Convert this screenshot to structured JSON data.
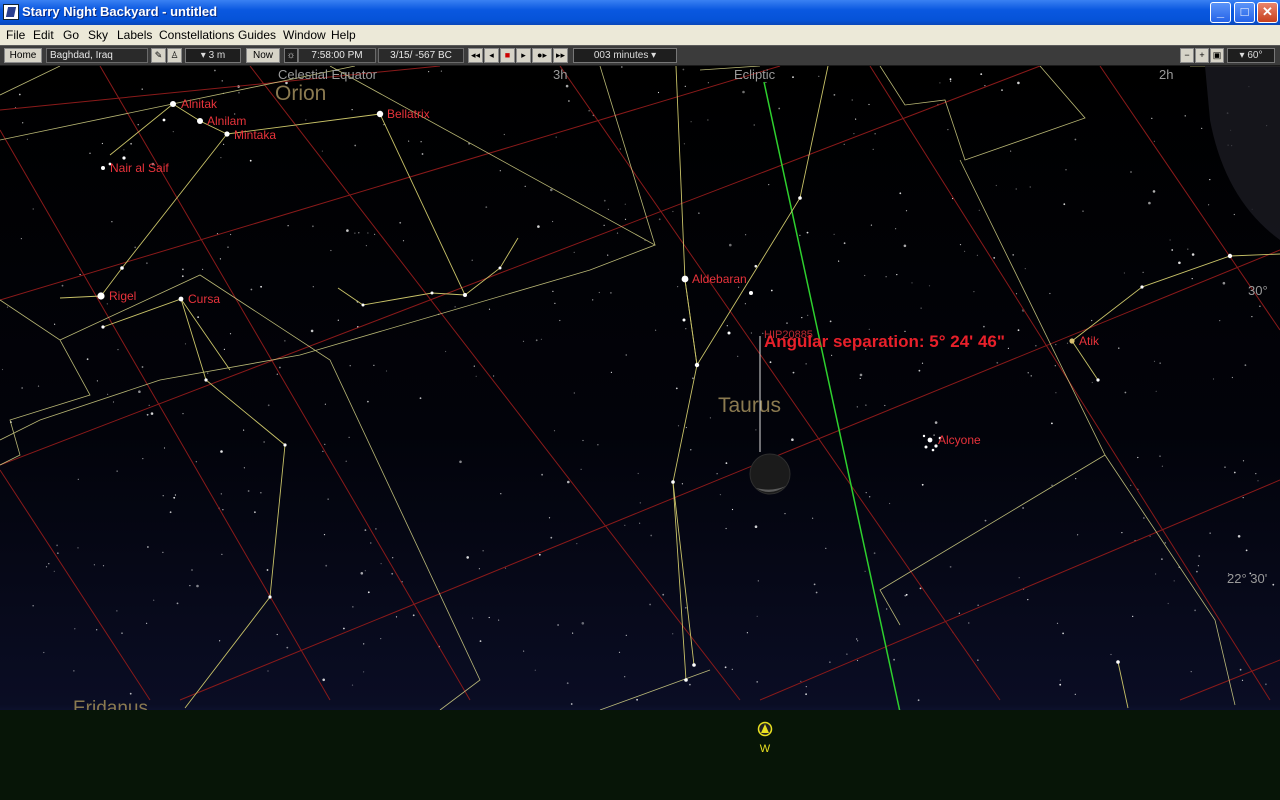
{
  "window": {
    "title": "Starry Night Backyard - untitled",
    "buttons": {
      "minimize": "_",
      "maximize": "□",
      "close": "✕"
    }
  },
  "menu": [
    "File",
    "Edit",
    "Go",
    "Sky",
    "Labels",
    "Constellations",
    "Guides",
    "Window",
    "Help"
  ],
  "toolbar": {
    "home_label": "Home",
    "location": "Baghdad, Iraq",
    "elevation": "▾ 3 m",
    "now_label": "Now",
    "time": "7:58:00 PM",
    "date": "3/15/ -567 BC",
    "time_step": "003 minutes ▾",
    "fov": "▾ 60°"
  },
  "sky": {
    "grid_labels": {
      "celestial_equator": "Celestial Equator",
      "ecliptic": "Ecliptic",
      "ra_3h": "3h",
      "ra_2h": "2h",
      "dec_30": "30°",
      "dec_22_30": "22° 30'"
    },
    "constellations": [
      "Orion",
      "Taurus",
      "Eridanus"
    ],
    "stars": [
      "Alnitak",
      "Alnilam",
      "Mintaka",
      "Bellatrix",
      "Nair al Saif",
      "Rigel",
      "Cursa",
      "Aldebaran",
      "HIP20885",
      "Atik",
      "Alcyone"
    ],
    "measurement": "Angular separation: 5° 24' 46\"",
    "compass": "W"
  },
  "colors": {
    "star_label": "#e8333b",
    "constellation_line": "#c8c268",
    "boundary": "#d8d688",
    "grid": "#8a1a1a",
    "ecliptic": "#2ed02e",
    "constellation_name": "#8b7a50",
    "titlebar": "#0a58e0"
  }
}
